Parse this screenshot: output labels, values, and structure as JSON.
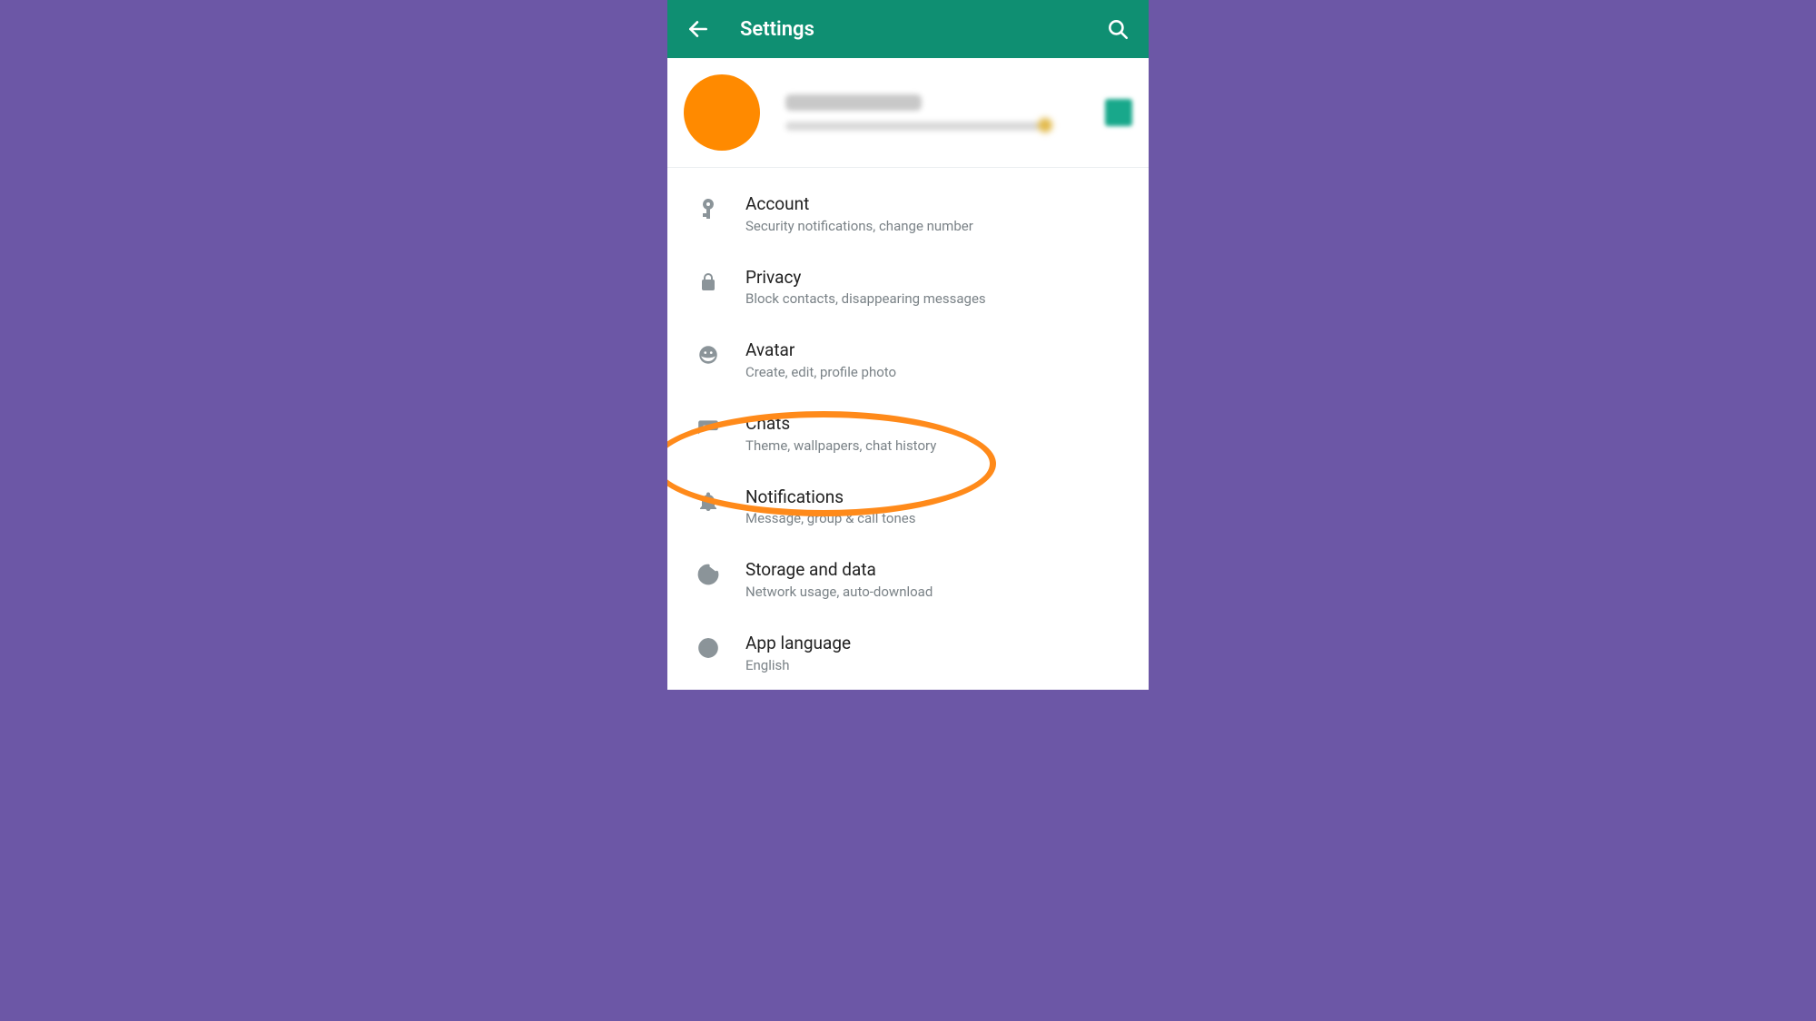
{
  "colors": {
    "background": "#6c57a6",
    "appbar": "#0f8f72",
    "highlight": "#ff8a1a",
    "avatar": "#ff8a00",
    "icon": "#8b9499"
  },
  "header": {
    "title": "Settings"
  },
  "profile": {
    "name_redacted": true,
    "status_redacted": true
  },
  "items": [
    {
      "icon": "key-icon",
      "title": "Account",
      "subtitle": "Security notifications, change number"
    },
    {
      "icon": "lock-icon",
      "title": "Privacy",
      "subtitle": "Block contacts, disappearing messages"
    },
    {
      "icon": "avatar-face-icon",
      "title": "Avatar",
      "subtitle": "Create, edit, profile photo"
    },
    {
      "icon": "chat-icon",
      "title": "Chats",
      "subtitle": "Theme, wallpapers, chat history"
    },
    {
      "icon": "bell-icon",
      "title": "Notifications",
      "subtitle": "Message, group & call tones"
    },
    {
      "icon": "data-circle-icon",
      "title": "Storage and data",
      "subtitle": "Network usage, auto-download"
    },
    {
      "icon": "globe-icon",
      "title": "App language",
      "subtitle": "English"
    }
  ],
  "highlight_index": 3
}
